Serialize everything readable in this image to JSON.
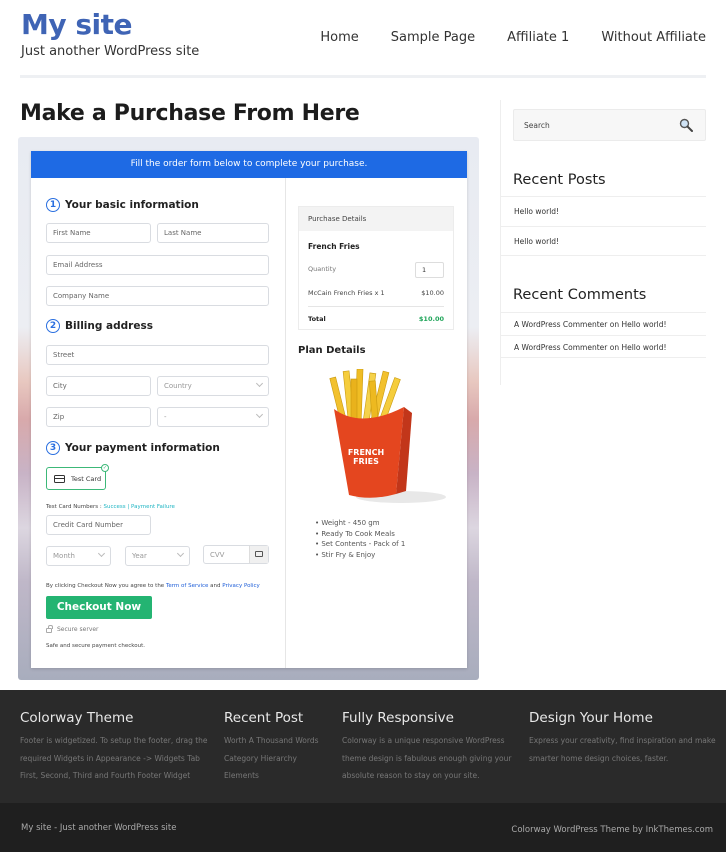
{
  "header": {
    "site_title": "My site",
    "tagline": "Just another WordPress site",
    "nav": [
      "Home",
      "Sample Page",
      "Affiliate 1",
      "Without Affiliate"
    ]
  },
  "page": {
    "title": "Make a Purchase From Here"
  },
  "form": {
    "banner": "Fill the order form below to complete your purchase.",
    "section1": {
      "num": "1",
      "title": "Your basic information"
    },
    "first_name_ph": "First Name",
    "last_name_ph": "Last Name",
    "email_ph": "Email Address",
    "company_ph": "Company Name",
    "section2": {
      "num": "2",
      "title": "Billing address"
    },
    "street_ph": "Street",
    "city_ph": "City",
    "country_ph": "Country",
    "zip_ph": "Zip",
    "state_ph": "-",
    "section3": {
      "num": "3",
      "title": "Your payment information"
    },
    "test_card_label": "Test Card",
    "test_card_numbers_label": "Test Card Numbers :",
    "success_link": "Success",
    "separator": "|",
    "failure_link": "Payment Failure",
    "card_number_ph": "Credit Card Number",
    "month_ph": "Month",
    "year_ph": "Year",
    "cvv_ph": "CVV",
    "agree_prefix": "By clicking Checkout Now you agree to the",
    "tos_link": "Term of Service",
    "agree_and": "and",
    "privacy_link": "Privacy Policy",
    "checkout_button": "Checkout Now",
    "secure_label": "Secure server",
    "safe_label": "Safe and secure payment checkout."
  },
  "purchase": {
    "header": "Purchase Details",
    "product": "French Fries",
    "quantity_label": "Quantity",
    "quantity_value": "1",
    "line_item": "McCain French Fries x 1",
    "line_price": "$10.00",
    "total_label": "Total",
    "total_price": "$10.00"
  },
  "plan": {
    "title": "Plan Details",
    "image_text": "FRENCH FRIES",
    "features": [
      "Weight - 450 gm",
      "Ready To Cook Meals",
      "Set Contents - Pack of 1",
      "Stir Fry & Enjoy"
    ]
  },
  "sidebar": {
    "search_ph": "Search",
    "recent_posts_title": "Recent Posts",
    "recent_posts": [
      "Hello world!",
      "Hello world!"
    ],
    "recent_comments_title": "Recent Comments",
    "recent_comments": [
      "A WordPress Commenter on Hello world!",
      "A WordPress Commenter on Hello world!"
    ]
  },
  "footer": {
    "cols": [
      {
        "title": "Colorway Theme",
        "lines": [
          "Footer is widgetized. To setup the footer, drag the",
          "required Widgets in Appearance -> Widgets Tab",
          "First, Second, Third and Fourth Footer Widget"
        ]
      },
      {
        "title": "Recent Post",
        "lines": [
          "Worth A Thousand Words",
          "Category Hierarchy",
          "Elements"
        ]
      },
      {
        "title": "Fully Responsive",
        "lines": [
          "Colorway is a unique responsive WordPress",
          "theme design is fabulous enough giving your",
          "absolute reason to stay on your site."
        ]
      },
      {
        "title": "Design Your Home",
        "lines": [
          "Express your creativity, find inspiration and make",
          "smarter home design choices, faster."
        ]
      }
    ],
    "bottom_left": "My site - Just another WordPress site",
    "bottom_right": "Colorway WordPress Theme by InkThemes.com"
  },
  "colors": {
    "brand": "#3f64b5",
    "banner": "#1e6ae4",
    "checkout": "#24b472",
    "total": "#20a55a"
  }
}
